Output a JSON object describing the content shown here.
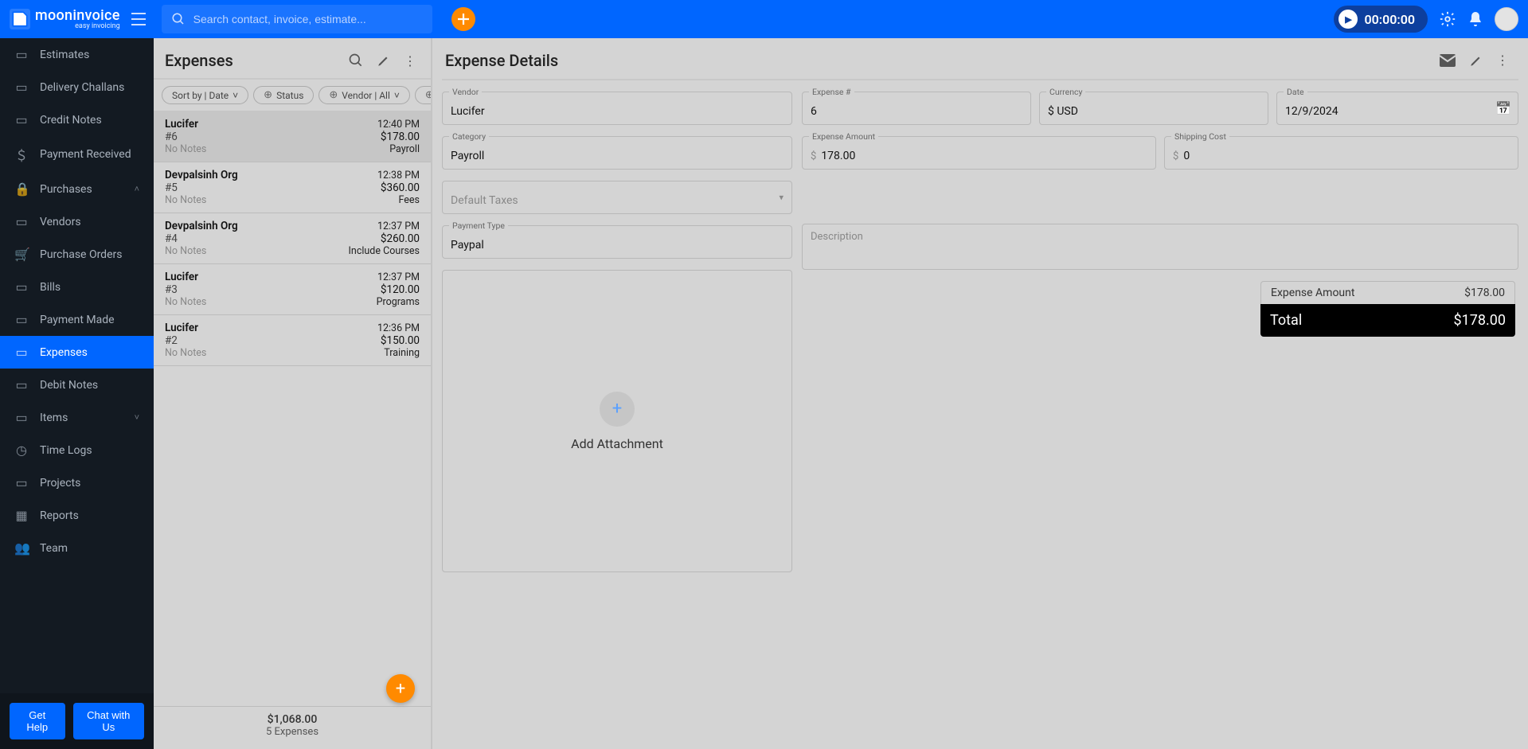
{
  "brand": {
    "name": "mooninvoice",
    "tagline": "easy invoicing"
  },
  "search": {
    "placeholder": "Search contact, invoice, estimate..."
  },
  "timer": {
    "value": "00:00:00"
  },
  "sidebar": {
    "items": [
      {
        "label": "Estimates",
        "icon": "📄"
      },
      {
        "label": "Delivery Challans",
        "icon": "🚚"
      },
      {
        "label": "Credit Notes",
        "icon": "📝"
      },
      {
        "label": "Payment Received",
        "icon": "💲"
      },
      {
        "label": "Purchases",
        "icon": "🔒",
        "expandable": true
      },
      {
        "label": "Vendors",
        "icon": "🏪"
      },
      {
        "label": "Purchase Orders",
        "icon": "🛒"
      },
      {
        "label": "Bills",
        "icon": "🧾"
      },
      {
        "label": "Payment Made",
        "icon": "💳"
      },
      {
        "label": "Expenses",
        "icon": "📂",
        "active": true
      },
      {
        "label": "Debit Notes",
        "icon": "📄"
      },
      {
        "label": "Items",
        "icon": "📦",
        "collapsible": true
      },
      {
        "label": "Time Logs",
        "icon": "🕒"
      },
      {
        "label": "Projects",
        "icon": "📁"
      },
      {
        "label": "Reports",
        "icon": "📊"
      },
      {
        "label": "Team",
        "icon": "👥"
      }
    ]
  },
  "footer": {
    "help": "Get Help",
    "chat": "Chat with Us"
  },
  "list": {
    "title": "Expenses",
    "sort_chip": "Sort by | Date",
    "status_chip": "Status",
    "vendor_chip": "Vendor | All",
    "items": [
      {
        "name": "Lucifer",
        "time": "12:40 PM",
        "num": "#6",
        "amt": "$178.00",
        "notes": "No Notes",
        "cat": "Payroll"
      },
      {
        "name": "Devpalsinh Org",
        "time": "12:38 PM",
        "num": "#5",
        "amt": "$360.00",
        "notes": "No Notes",
        "cat": "Fees"
      },
      {
        "name": "Devpalsinh Org",
        "time": "12:37 PM",
        "num": "#4",
        "amt": "$260.00",
        "notes": "No Notes",
        "cat": "Include Courses"
      },
      {
        "name": "Lucifer",
        "time": "12:37 PM",
        "num": "#3",
        "amt": "$120.00",
        "notes": "No Notes",
        "cat": "Programs"
      },
      {
        "name": "Lucifer",
        "time": "12:36 PM",
        "num": "#2",
        "amt": "$150.00",
        "notes": "No Notes",
        "cat": "Training"
      }
    ],
    "total_amount": "$1,068.00",
    "total_count": "5 Expenses"
  },
  "detail": {
    "title": "Expense Details",
    "vendor_label": "Vendor",
    "vendor": "Lucifer",
    "category_label": "Category",
    "category": "Payroll",
    "taxes_label": "Default Taxes",
    "paytype_label": "Payment Type",
    "paytype": "Paypal",
    "attach_label": "Add Attachment",
    "expnum_label": "Expense #",
    "expnum": "6",
    "currency_label": "Currency",
    "currency": "$ USD",
    "date_label": "Date",
    "date": "12/9/2024",
    "amount_label": "Expense Amount",
    "amount": "178.00",
    "shipping_label": "Shipping Cost",
    "shipping": "0",
    "desc_label": "Description",
    "summary_amount_label": "Expense Amount",
    "summary_amount": "$178.00",
    "total_label": "Total",
    "total": "$178.00"
  }
}
